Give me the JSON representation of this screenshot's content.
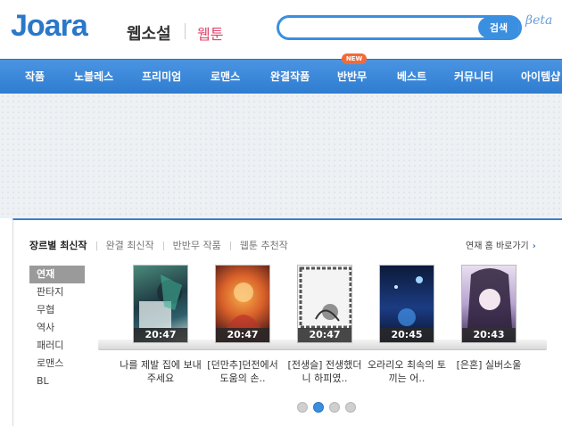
{
  "header": {
    "logo_text": "Joara",
    "webnovel": "웹소설",
    "webtoon": "웹툰",
    "search_placeholder": "",
    "search_button": "검색",
    "beta": "βeta"
  },
  "nav": {
    "items": [
      "작품",
      "노블레스",
      "프리미엄",
      "로맨스",
      "완결작품",
      "반반무",
      "베스트",
      "커뮤니티",
      "아이템샵"
    ],
    "new_badge": "NEW"
  },
  "panel": {
    "tabs": [
      "장르별 최신작",
      "완결 최신작",
      "반반무 작품",
      "웹툰 추천작"
    ],
    "shortcut": "연재 홈 바로가기",
    "genres": [
      "연재",
      "판타지",
      "무협",
      "역사",
      "패러디",
      "로맨스",
      "BL"
    ],
    "books": [
      {
        "time": "20:47",
        "title": "나를 제발 집에 보내주세요"
      },
      {
        "time": "20:47",
        "title": "[던만추]던전에서 도움의 손.."
      },
      {
        "time": "20:47",
        "title": "[전생슬] 전생했더니 하피였.."
      },
      {
        "time": "20:45",
        "title": "오라리오 최속의 토끼는 어.."
      },
      {
        "time": "20:43",
        "title": "[은혼] 실버소울"
      }
    ],
    "pager_active": 2,
    "pager_count": 4
  },
  "colors": {
    "accent": "#3b8fe0",
    "nav_bg": "#3a86d8",
    "webtoon": "#e0456a"
  }
}
